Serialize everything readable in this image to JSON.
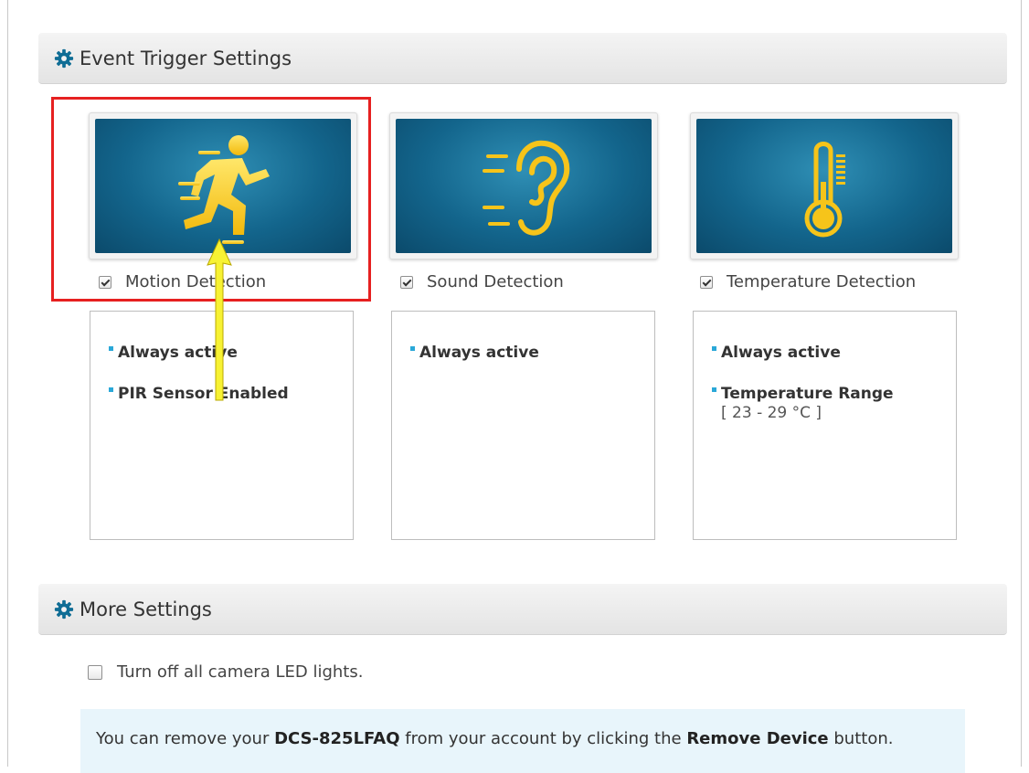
{
  "event_trigger": {
    "title": "Event Trigger Settings",
    "triggers": [
      {
        "label": "Motion Detection",
        "checked": true,
        "icon": "running-person-icon",
        "details": [
          "Always active",
          "PIR Sensor Enabled"
        ]
      },
      {
        "label": "Sound Detection",
        "checked": true,
        "icon": "ear-icon",
        "details": [
          "Always active"
        ]
      },
      {
        "label": "Temperature Detection",
        "checked": true,
        "icon": "thermometer-icon",
        "details": [
          "Always active",
          "Temperature Range"
        ],
        "range": "[ 23 - 29 °C ]"
      }
    ]
  },
  "more_settings": {
    "title": "More Settings",
    "led_option": {
      "label": "Turn off all camera LED lights.",
      "checked": false
    },
    "remove_notice": {
      "prefix": "You can remove your ",
      "device": "DCS-825LFAQ",
      "middle": " from your account by clicking the ",
      "button_name": "Remove Device",
      "suffix": " button."
    }
  },
  "colors": {
    "tile_blue": "#13658c",
    "icon_yellow": "#f6c41a",
    "bullet": "#2aa8d8",
    "highlight_red": "#e62020",
    "arrow_yellow": "#f7f233",
    "notice_bg": "#e8f5fb"
  }
}
